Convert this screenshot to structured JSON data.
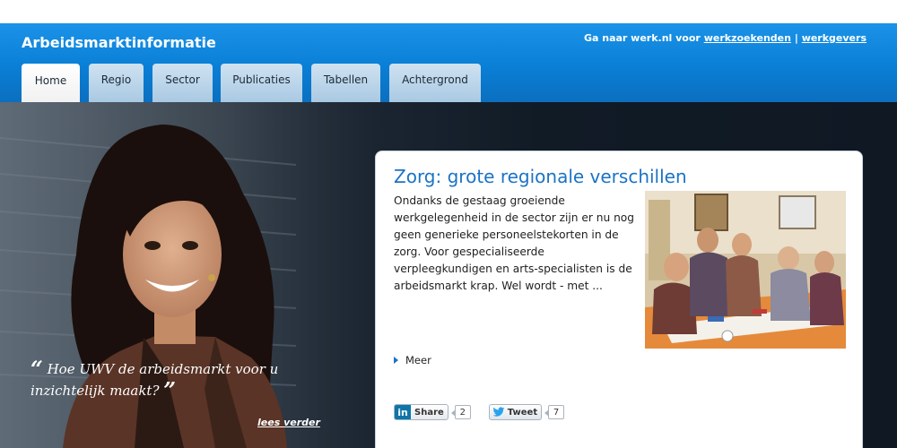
{
  "header": {
    "site_title": "Arbeidsmarktinformatie",
    "werk_prefix": "Ga naar werk.nl voor",
    "werk_link1": "werkzoekenden",
    "separator": "|",
    "werk_link2": "werkgevers"
  },
  "tabs": [
    {
      "label": "Home",
      "active": true
    },
    {
      "label": "Regio",
      "active": false
    },
    {
      "label": "Sector",
      "active": false
    },
    {
      "label": "Publicaties",
      "active": false
    },
    {
      "label": "Tabellen",
      "active": false
    },
    {
      "label": "Achtergrond",
      "active": false
    }
  ],
  "hero": {
    "quote_open": "“",
    "quote_text": "Hoe UWV de arbeidsmarkt voor u inzichtelijk maakt?",
    "quote_close": "”",
    "read_more": "lees verder"
  },
  "article": {
    "title": "Zorg: grote regionale verschillen",
    "text": "Ondanks de gestaag groeiende werkgelegenheid in de sector zijn er nu nog geen generieke personeelstekorten in de zorg. Voor gespecialiseerde verpleegkundigen en arts-specialisten is de arbeidsmarkt krap. Wel wordt - met ...",
    "more": "Meer"
  },
  "social": {
    "share_logo": "in",
    "share_label": "Share",
    "share_count": "2",
    "tweet_label": "Tweet",
    "tweet_count": "7"
  },
  "colors": {
    "header_blue": "#0a7fd6",
    "link_blue": "#1b73c5",
    "hero_dark": "#111b26"
  },
  "icons": [
    "linkedin-icon",
    "twitter-bird-icon",
    "triangle-right-icon"
  ]
}
